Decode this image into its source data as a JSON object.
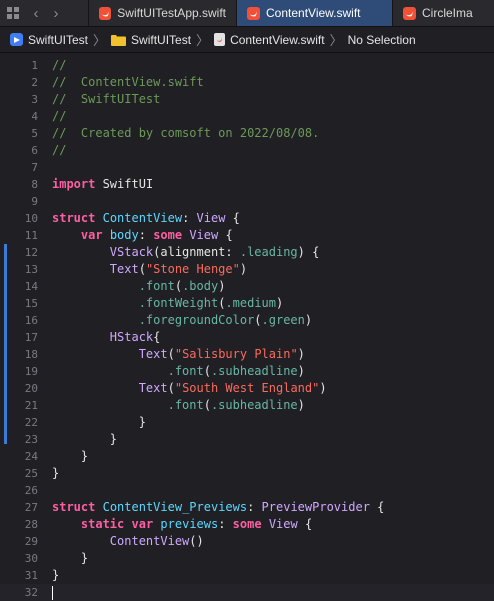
{
  "tabs": [
    {
      "label": "SwiftUITestApp.swift",
      "active": false
    },
    {
      "label": "ContentView.swift",
      "active": true
    },
    {
      "label": "CircleIma",
      "active": false
    }
  ],
  "breadcrumb": {
    "project": "SwiftUITest",
    "folder": "SwiftUITest",
    "file": "ContentView.swift",
    "selection": "No Selection"
  },
  "colors": {
    "accent_tab": "#2f4b78",
    "swift_icon": "#f05138",
    "project_icon": "#3f7ef0",
    "change_bar": "#3a7bd5"
  },
  "icons": [
    "grid-icon",
    "back-arrow-icon",
    "forward-arrow-icon",
    "swift-file-icon",
    "project-icon",
    "folder-icon",
    "file-icon",
    "chevron-right-icon"
  ],
  "editor": {
    "lines": [
      {
        "n": "1",
        "tokens": [
          [
            "comment",
            "//"
          ]
        ]
      },
      {
        "n": "2",
        "tokens": [
          [
            "comment",
            "//  ContentView.swift"
          ]
        ]
      },
      {
        "n": "3",
        "tokens": [
          [
            "comment",
            "//  SwiftUITest"
          ]
        ]
      },
      {
        "n": "4",
        "tokens": [
          [
            "comment",
            "//"
          ]
        ]
      },
      {
        "n": "5",
        "tokens": [
          [
            "comment",
            "//  Created by comsoft on 2022/08/08."
          ]
        ]
      },
      {
        "n": "6",
        "tokens": [
          [
            "comment",
            "//"
          ]
        ]
      },
      {
        "n": "7",
        "tokens": []
      },
      {
        "n": "8",
        "tokens": [
          [
            "kw",
            "import"
          ],
          [
            "plain",
            " SwiftUI"
          ]
        ]
      },
      {
        "n": "9",
        "tokens": []
      },
      {
        "n": "10",
        "tokens": [
          [
            "kw",
            "struct"
          ],
          [
            "plain",
            " "
          ],
          [
            "type",
            "ContentView"
          ],
          [
            "plain",
            ": "
          ],
          [
            "sys",
            "View"
          ],
          [
            "plain",
            " {"
          ]
        ]
      },
      {
        "n": "11",
        "tokens": [
          [
            "plain",
            "    "
          ],
          [
            "kw",
            "var"
          ],
          [
            "plain",
            " "
          ],
          [
            "type",
            "body"
          ],
          [
            "plain",
            ": "
          ],
          [
            "kw",
            "some"
          ],
          [
            "plain",
            " "
          ],
          [
            "sys",
            "View"
          ],
          [
            "plain",
            " {"
          ]
        ]
      },
      {
        "n": "12",
        "tokens": [
          [
            "plain",
            "        "
          ],
          [
            "sys",
            "VStack"
          ],
          [
            "plain",
            "(alignment: "
          ],
          [
            "member",
            ".leading"
          ],
          [
            "plain",
            ") {"
          ]
        ]
      },
      {
        "n": "13",
        "tokens": [
          [
            "plain",
            "        "
          ],
          [
            "sys",
            "Text"
          ],
          [
            "plain",
            "("
          ],
          [
            "str",
            "\"Stone Henge\""
          ],
          [
            "plain",
            ")"
          ]
        ]
      },
      {
        "n": "14",
        "tokens": [
          [
            "plain",
            "            "
          ],
          [
            "member",
            ".font"
          ],
          [
            "plain",
            "("
          ],
          [
            "member",
            ".body"
          ],
          [
            "plain",
            ")"
          ]
        ]
      },
      {
        "n": "15",
        "tokens": [
          [
            "plain",
            "            "
          ],
          [
            "member",
            ".fontWeight"
          ],
          [
            "plain",
            "("
          ],
          [
            "member",
            ".medium"
          ],
          [
            "plain",
            ")"
          ]
        ]
      },
      {
        "n": "16",
        "tokens": [
          [
            "plain",
            "            "
          ],
          [
            "member",
            ".foregroundColor"
          ],
          [
            "plain",
            "("
          ],
          [
            "member",
            ".green"
          ],
          [
            "plain",
            ")"
          ]
        ]
      },
      {
        "n": "17",
        "tokens": [
          [
            "plain",
            "        "
          ],
          [
            "sys",
            "HStack"
          ],
          [
            "plain",
            "{"
          ]
        ]
      },
      {
        "n": "18",
        "tokens": [
          [
            "plain",
            "            "
          ],
          [
            "sys",
            "Text"
          ],
          [
            "plain",
            "("
          ],
          [
            "str",
            "\"Salisbury Plain\""
          ],
          [
            "plain",
            ")"
          ]
        ]
      },
      {
        "n": "19",
        "tokens": [
          [
            "plain",
            "                "
          ],
          [
            "member",
            ".font"
          ],
          [
            "plain",
            "("
          ],
          [
            "member",
            ".subheadline"
          ],
          [
            "plain",
            ")"
          ]
        ]
      },
      {
        "n": "20",
        "tokens": [
          [
            "plain",
            "            "
          ],
          [
            "sys",
            "Text"
          ],
          [
            "plain",
            "("
          ],
          [
            "str",
            "\"South West England\""
          ],
          [
            "plain",
            ")"
          ]
        ]
      },
      {
        "n": "21",
        "tokens": [
          [
            "plain",
            "                "
          ],
          [
            "member",
            ".font"
          ],
          [
            "plain",
            "("
          ],
          [
            "member",
            ".subheadline"
          ],
          [
            "plain",
            ")"
          ]
        ]
      },
      {
        "n": "22",
        "tokens": [
          [
            "plain",
            "            }"
          ]
        ]
      },
      {
        "n": "23",
        "tokens": [
          [
            "plain",
            "        }"
          ]
        ]
      },
      {
        "n": "24",
        "tokens": [
          [
            "plain",
            "    }"
          ]
        ]
      },
      {
        "n": "25",
        "tokens": [
          [
            "plain",
            "}"
          ]
        ]
      },
      {
        "n": "26",
        "tokens": []
      },
      {
        "n": "27",
        "tokens": [
          [
            "kw",
            "struct"
          ],
          [
            "plain",
            " "
          ],
          [
            "type",
            "ContentView_Previews"
          ],
          [
            "plain",
            ": "
          ],
          [
            "sys",
            "PreviewProvider"
          ],
          [
            "plain",
            " {"
          ]
        ]
      },
      {
        "n": "28",
        "tokens": [
          [
            "plain",
            "    "
          ],
          [
            "kw",
            "static"
          ],
          [
            "plain",
            " "
          ],
          [
            "kw",
            "var"
          ],
          [
            "plain",
            " "
          ],
          [
            "type",
            "previews"
          ],
          [
            "plain",
            ": "
          ],
          [
            "kw",
            "some"
          ],
          [
            "plain",
            " "
          ],
          [
            "sys",
            "View"
          ],
          [
            "plain",
            " {"
          ]
        ]
      },
      {
        "n": "29",
        "tokens": [
          [
            "plain",
            "        "
          ],
          [
            "sys",
            "ContentView"
          ],
          [
            "plain",
            "()"
          ]
        ]
      },
      {
        "n": "30",
        "tokens": [
          [
            "plain",
            "    }"
          ]
        ]
      },
      {
        "n": "31",
        "tokens": [
          [
            "plain",
            "}"
          ]
        ]
      },
      {
        "n": "32",
        "tokens": []
      }
    ]
  }
}
